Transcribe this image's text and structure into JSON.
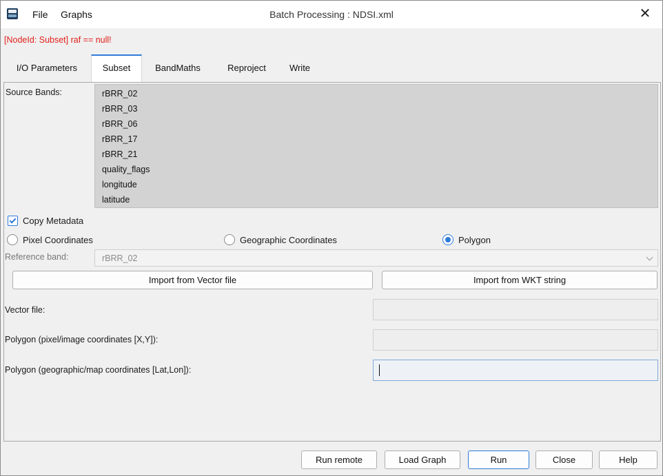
{
  "window": {
    "title": "Batch Processing : NDSI.xml",
    "close_glyph": "✕",
    "menu": [
      "File",
      "Graphs"
    ],
    "icon": "snap-app-icon"
  },
  "error_message": "[NodeId: Subset] raf == null!",
  "tabs": [
    {
      "label": "I/O Parameters",
      "active": false
    },
    {
      "label": "Subset",
      "active": true
    },
    {
      "label": "BandMaths",
      "active": false
    },
    {
      "label": "Reproject",
      "active": false
    },
    {
      "label": "Write",
      "active": false
    }
  ],
  "subset": {
    "source_bands_label": "Source Bands:",
    "bands": [
      "rBRR_02",
      "rBRR_03",
      "rBRR_06",
      "rBRR_17",
      "rBRR_21",
      "quality_flags",
      "longitude",
      "latitude"
    ],
    "copy_metadata": {
      "label": "Copy Metadata",
      "checked": true
    },
    "region_modes": [
      {
        "label": "Pixel Coordinates",
        "selected": false
      },
      {
        "label": "Geographic Coordinates",
        "selected": false
      },
      {
        "label": "Polygon",
        "selected": true
      }
    ],
    "reference_band": {
      "label": "Reference band:",
      "value": "rBRR_02"
    },
    "import_vector_label": "Import from Vector file",
    "import_wkt_label": "Import from WKT string",
    "vector_file": {
      "label": "Vector file:",
      "value": ""
    },
    "polygon_pixel": {
      "label": "Polygon (pixel/image coordinates [X,Y]):",
      "value": ""
    },
    "polygon_geo": {
      "label": "Polygon (geographic/map coordinates [Lat,Lon]):",
      "value": ""
    }
  },
  "footer_buttons": [
    "Run remote",
    "Load Graph",
    "Run",
    "Close",
    "Help"
  ],
  "colors": {
    "accent": "#2f7ad9",
    "error": "#e0201b",
    "list_bg": "#d3d3d3"
  }
}
